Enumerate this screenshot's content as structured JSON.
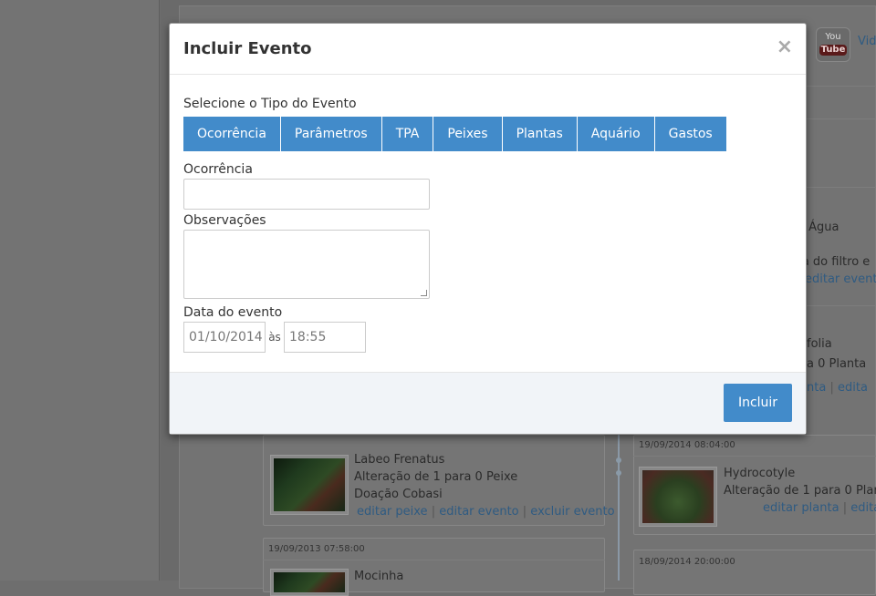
{
  "modal": {
    "title": "Incluir Evento",
    "close_symbol": "×",
    "event_type_label": "Selecione o Tipo do Evento",
    "tabs": [
      {
        "label": "Ocorrência"
      },
      {
        "label": "Parâmetros"
      },
      {
        "label": "TPA"
      },
      {
        "label": "Peixes"
      },
      {
        "label": "Plantas"
      },
      {
        "label": "Aquário"
      },
      {
        "label": "Gastos"
      }
    ],
    "occurrence_label": "Ocorrência",
    "occurrence_value": "",
    "observations_label": "Observações",
    "observations_value": "",
    "date_label": "Data do evento",
    "date_value": "01/10/2014",
    "at_label": "às",
    "time_value": "18:55",
    "submit_label": "Incluir"
  },
  "background": {
    "youtube_icon_top": "You",
    "youtube_icon_bottom": "Tube",
    "video_link": "Vid",
    "right_entries": [
      {
        "title_fragment": "e Água",
        "text_fragment": "za do filtro e",
        "link_fragment": "editar evento"
      },
      {
        "title_fragment": "folia",
        "text_fragment": "a 0 Planta",
        "link1": "nta",
        "link2": "edita"
      }
    ],
    "left_card_header": "",
    "fish_entry": {
      "title": "Labeo Frenatus",
      "change": "Alteração de 1 para 0 Peixe",
      "note": "Doação Cobasi",
      "link_edit_fish": "editar peixe",
      "link_edit_event": "editar evento",
      "link_delete_event": "excluir evento"
    },
    "plant_entry": {
      "timestamp": "19/09/2014 08:04:00",
      "title": "Hydrocotyle",
      "change": "Alteração de 1 para 0 Planta",
      "link_edit_plant": "editar planta",
      "link_edit_event": "edita"
    },
    "next_left_timestamp": "19/09/2013 07:58:00",
    "next_left_title": "Mocinha",
    "next_right_timestamp": "18/09/2014 20:00:00",
    "separator": "|"
  },
  "colors": {
    "accent": "#428bca",
    "footer_bg": "#f1f4f8",
    "overlay_bg": "#6e6e6e"
  }
}
